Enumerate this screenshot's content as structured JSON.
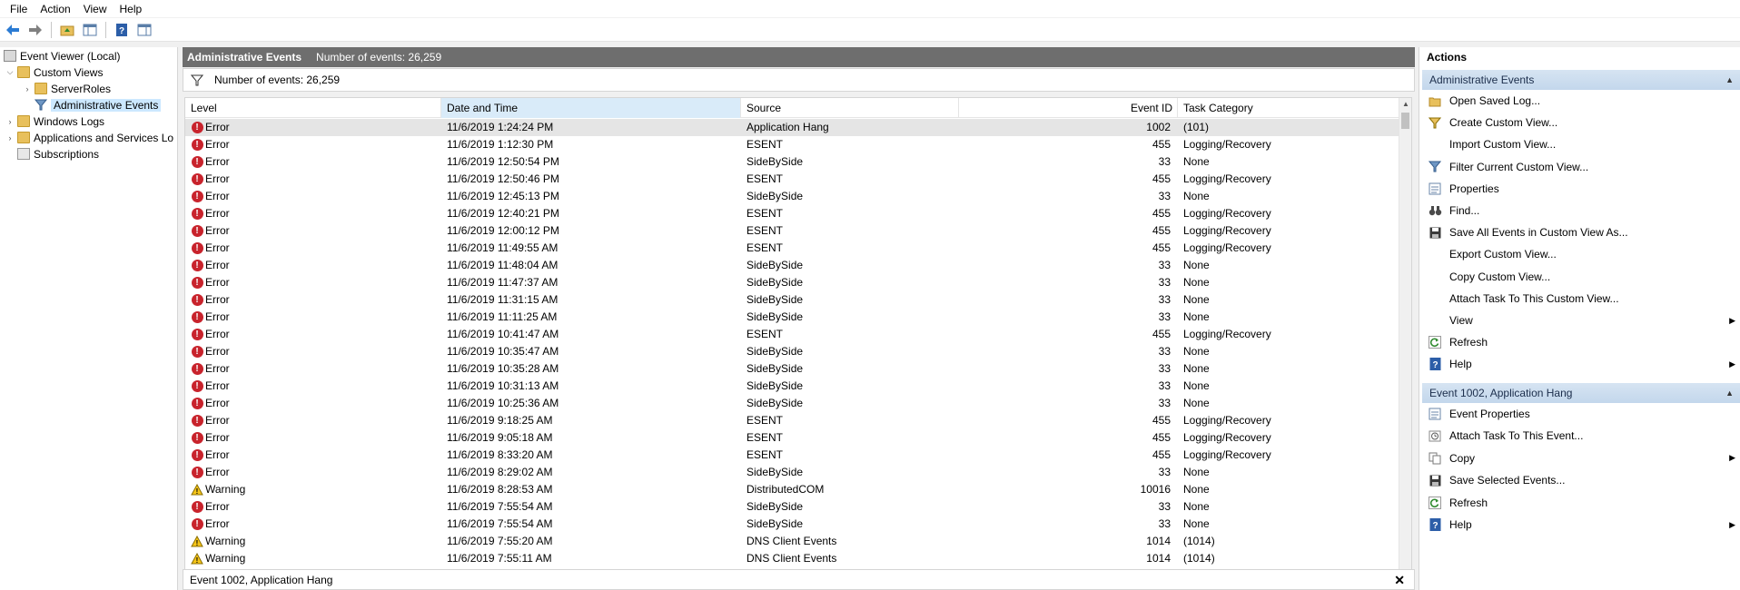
{
  "menu": [
    "File",
    "Action",
    "View",
    "Help"
  ],
  "tree": {
    "root": "Event Viewer (Local)",
    "custom_views": "Custom Views",
    "server_roles": "ServerRoles",
    "admin_events": "Administrative Events",
    "windows_logs": "Windows Logs",
    "apps_services": "Applications and Services Lo",
    "subscriptions": "Subscriptions"
  },
  "center": {
    "title": "Administrative Events",
    "count_label": "Number of events: 26,259",
    "filter_label": "Number of events: 26,259",
    "columns": {
      "level": "Level",
      "date": "Date and Time",
      "source": "Source",
      "event_id": "Event ID",
      "category": "Task Category"
    },
    "rows": [
      {
        "level": "Error",
        "date": "11/6/2019 1:24:24 PM",
        "source": "Application Hang",
        "id": "1002",
        "cat": "(101)"
      },
      {
        "level": "Error",
        "date": "11/6/2019 1:12:30 PM",
        "source": "ESENT",
        "id": "455",
        "cat": "Logging/Recovery"
      },
      {
        "level": "Error",
        "date": "11/6/2019 12:50:54 PM",
        "source": "SideBySide",
        "id": "33",
        "cat": "None"
      },
      {
        "level": "Error",
        "date": "11/6/2019 12:50:46 PM",
        "source": "ESENT",
        "id": "455",
        "cat": "Logging/Recovery"
      },
      {
        "level": "Error",
        "date": "11/6/2019 12:45:13 PM",
        "source": "SideBySide",
        "id": "33",
        "cat": "None"
      },
      {
        "level": "Error",
        "date": "11/6/2019 12:40:21 PM",
        "source": "ESENT",
        "id": "455",
        "cat": "Logging/Recovery"
      },
      {
        "level": "Error",
        "date": "11/6/2019 12:00:12 PM",
        "source": "ESENT",
        "id": "455",
        "cat": "Logging/Recovery"
      },
      {
        "level": "Error",
        "date": "11/6/2019 11:49:55 AM",
        "source": "ESENT",
        "id": "455",
        "cat": "Logging/Recovery"
      },
      {
        "level": "Error",
        "date": "11/6/2019 11:48:04 AM",
        "source": "SideBySide",
        "id": "33",
        "cat": "None"
      },
      {
        "level": "Error",
        "date": "11/6/2019 11:47:37 AM",
        "source": "SideBySide",
        "id": "33",
        "cat": "None"
      },
      {
        "level": "Error",
        "date": "11/6/2019 11:31:15 AM",
        "source": "SideBySide",
        "id": "33",
        "cat": "None"
      },
      {
        "level": "Error",
        "date": "11/6/2019 11:11:25 AM",
        "source": "SideBySide",
        "id": "33",
        "cat": "None"
      },
      {
        "level": "Error",
        "date": "11/6/2019 10:41:47 AM",
        "source": "ESENT",
        "id": "455",
        "cat": "Logging/Recovery"
      },
      {
        "level": "Error",
        "date": "11/6/2019 10:35:47 AM",
        "source": "SideBySide",
        "id": "33",
        "cat": "None"
      },
      {
        "level": "Error",
        "date": "11/6/2019 10:35:28 AM",
        "source": "SideBySide",
        "id": "33",
        "cat": "None"
      },
      {
        "level": "Error",
        "date": "11/6/2019 10:31:13 AM",
        "source": "SideBySide",
        "id": "33",
        "cat": "None"
      },
      {
        "level": "Error",
        "date": "11/6/2019 10:25:36 AM",
        "source": "SideBySide",
        "id": "33",
        "cat": "None"
      },
      {
        "level": "Error",
        "date": "11/6/2019 9:18:25 AM",
        "source": "ESENT",
        "id": "455",
        "cat": "Logging/Recovery"
      },
      {
        "level": "Error",
        "date": "11/6/2019 9:05:18 AM",
        "source": "ESENT",
        "id": "455",
        "cat": "Logging/Recovery"
      },
      {
        "level": "Error",
        "date": "11/6/2019 8:33:20 AM",
        "source": "ESENT",
        "id": "455",
        "cat": "Logging/Recovery"
      },
      {
        "level": "Error",
        "date": "11/6/2019 8:29:02 AM",
        "source": "SideBySide",
        "id": "33",
        "cat": "None"
      },
      {
        "level": "Warning",
        "date": "11/6/2019 8:28:53 AM",
        "source": "DistributedCOM",
        "id": "10016",
        "cat": "None"
      },
      {
        "level": "Error",
        "date": "11/6/2019 7:55:54 AM",
        "source": "SideBySide",
        "id": "33",
        "cat": "None"
      },
      {
        "level": "Error",
        "date": "11/6/2019 7:55:54 AM",
        "source": "SideBySide",
        "id": "33",
        "cat": "None"
      },
      {
        "level": "Warning",
        "date": "11/6/2019 7:55:20 AM",
        "source": "DNS Client Events",
        "id": "1014",
        "cat": "(1014)"
      },
      {
        "level": "Warning",
        "date": "11/6/2019 7:55:11 AM",
        "source": "DNS Client Events",
        "id": "1014",
        "cat": "(1014)"
      }
    ],
    "detail_title": "Event 1002, Application Hang"
  },
  "actions": {
    "title": "Actions",
    "section1": "Administrative Events",
    "items1": [
      {
        "label": "Open Saved Log...",
        "icon": "open-folder-icon",
        "submenu": false
      },
      {
        "label": "Create Custom View...",
        "icon": "filter-create-icon",
        "submenu": false
      },
      {
        "label": "Import Custom View...",
        "icon": "none",
        "submenu": false
      },
      {
        "label": "Filter Current Custom View...",
        "icon": "filter-icon",
        "submenu": false
      },
      {
        "label": "Properties",
        "icon": "properties-icon",
        "submenu": false
      },
      {
        "label": "Find...",
        "icon": "binoculars-icon",
        "submenu": false
      },
      {
        "label": "Save All Events in Custom View As...",
        "icon": "save-icon",
        "submenu": false
      },
      {
        "label": "Export Custom View...",
        "icon": "none",
        "submenu": false
      },
      {
        "label": "Copy Custom View...",
        "icon": "none",
        "submenu": false
      },
      {
        "label": "Attach Task To This Custom View...",
        "icon": "none",
        "submenu": false
      },
      {
        "label": "View",
        "icon": "none",
        "submenu": true
      },
      {
        "label": "Refresh",
        "icon": "refresh-icon",
        "submenu": false
      },
      {
        "label": "Help",
        "icon": "help-icon",
        "submenu": true
      }
    ],
    "section2": "Event 1002, Application Hang",
    "items2": [
      {
        "label": "Event Properties",
        "icon": "properties-icon",
        "submenu": false
      },
      {
        "label": "Attach Task To This Event...",
        "icon": "task-icon",
        "submenu": false
      },
      {
        "label": "Copy",
        "icon": "copy-icon",
        "submenu": true
      },
      {
        "label": "Save Selected Events...",
        "icon": "save-icon",
        "submenu": false
      },
      {
        "label": "Refresh",
        "icon": "refresh-icon",
        "submenu": false
      },
      {
        "label": "Help",
        "icon": "help-icon",
        "submenu": true
      }
    ]
  },
  "colors": {
    "header_gray": "#6e6e6e",
    "section_blue": "#c3d7ec",
    "selected_tree": "#cce8ff",
    "error_red": "#c8232c",
    "warning_yellow": "#f5c518"
  }
}
